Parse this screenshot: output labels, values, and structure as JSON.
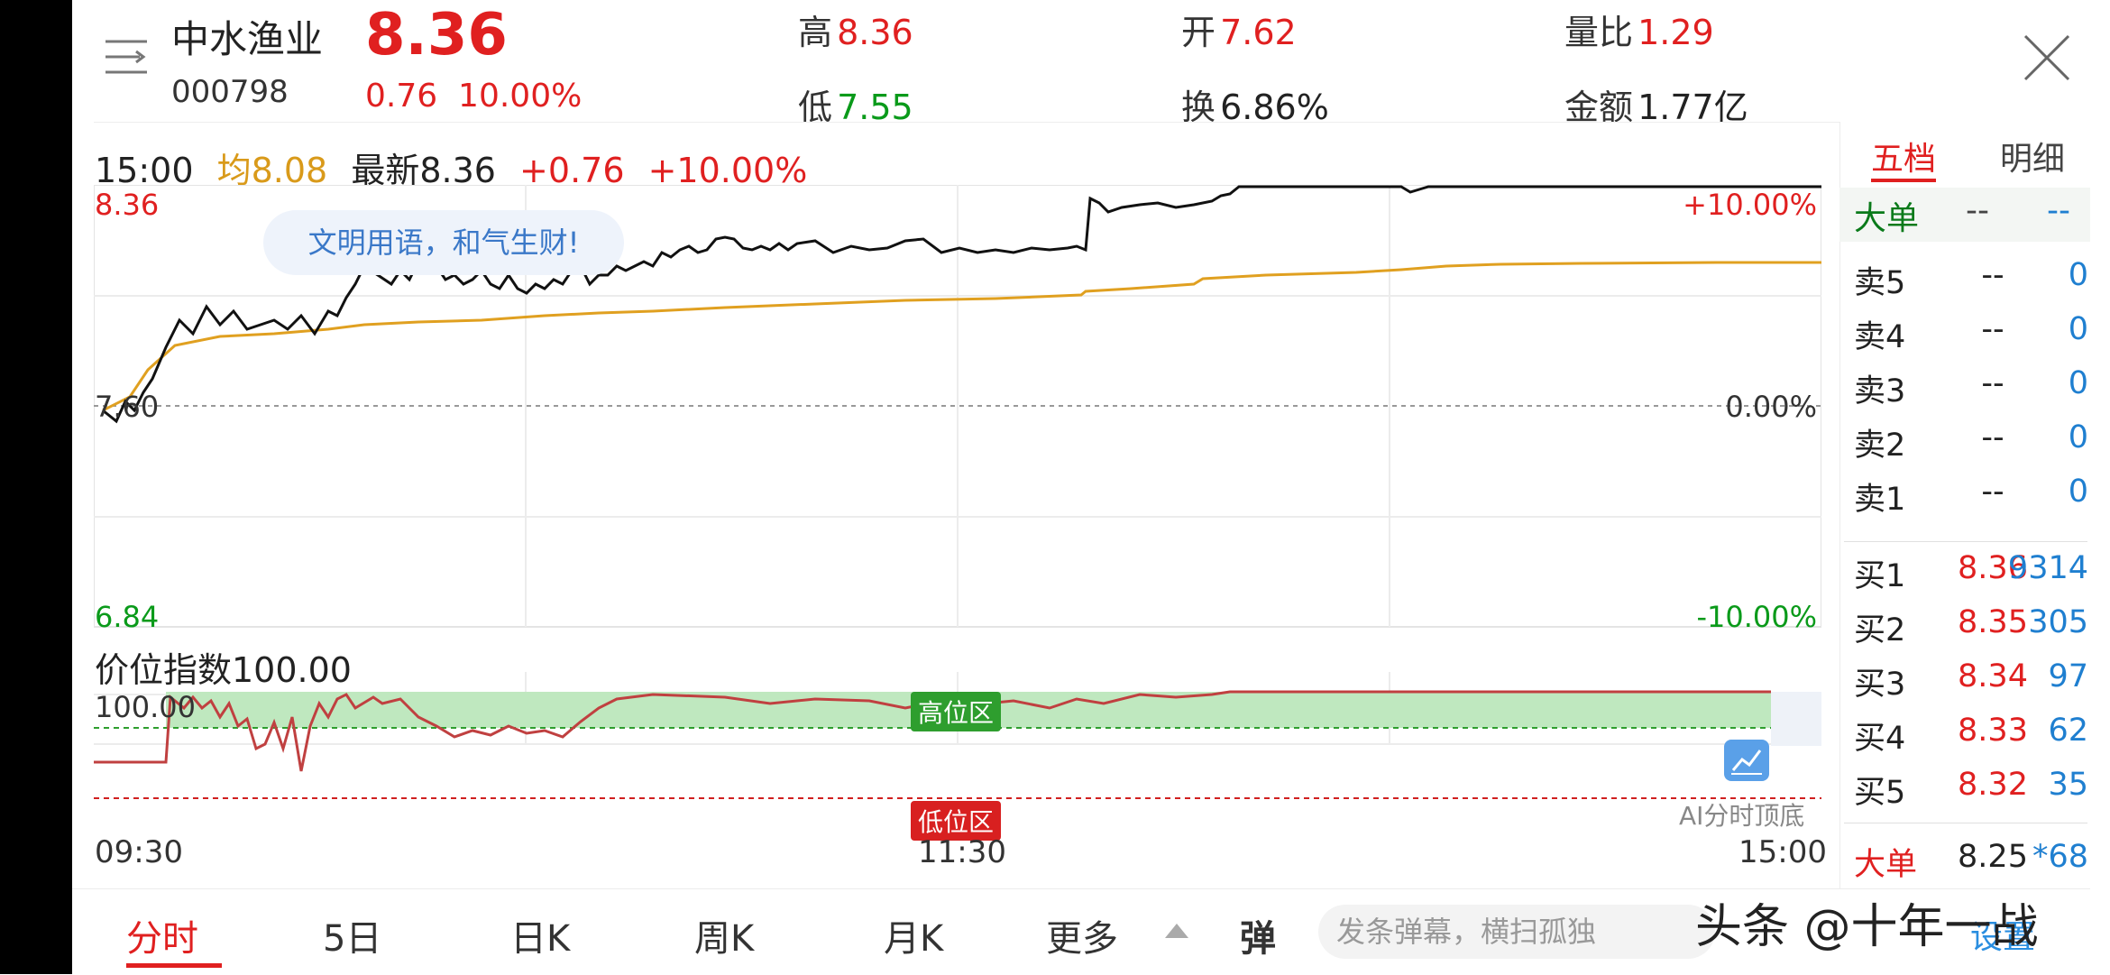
{
  "header": {
    "stock_name": "中水渔业",
    "stock_code": "000798",
    "price": "8.36",
    "change": "0.76",
    "change_pct": "10.00%",
    "high_label": "高",
    "high_value": "8.36",
    "low_label": "低",
    "low_value": "7.55",
    "open_label": "开",
    "open_value": "7.62",
    "turnover_label": "换",
    "turnover_value": "6.86%",
    "vol_ratio_label": "量比",
    "vol_ratio_value": "1.29",
    "amount_label": "金额",
    "amount_value": "1.77亿"
  },
  "info_line": {
    "time": "15:00",
    "avg_label": "均8.08",
    "latest_label": "最新8.36",
    "change": "+0.76",
    "change_pct": "+10.00%"
  },
  "chart_axes": {
    "y_top": "8.36",
    "y_mid": "7.60",
    "y_bottom": "6.84",
    "pct_top": "+10.00%",
    "pct_mid": "0.00%",
    "pct_bottom": "-10.00%",
    "x_start": "09:30",
    "x_mid": "11:30",
    "x_end": "15:00"
  },
  "bubble_text": "文明用语，和气生财!",
  "index_panel": {
    "title": "价位指数100.00",
    "level_100": "100.00",
    "high_zone": "高位区",
    "low_zone": "低位区"
  },
  "ai_label": "AI分时顶底",
  "right_panel": {
    "tabs": [
      "五档",
      "明细"
    ],
    "big_order_label": "大单",
    "big_order_price": "--",
    "big_order_vol": "--",
    "asks": [
      {
        "label": "卖5",
        "price": "--",
        "vol": "0"
      },
      {
        "label": "卖4",
        "price": "--",
        "vol": "0"
      },
      {
        "label": "卖3",
        "price": "--",
        "vol": "0"
      },
      {
        "label": "卖2",
        "price": "--",
        "vol": "0"
      },
      {
        "label": "卖1",
        "price": "--",
        "vol": "0"
      }
    ],
    "bids": [
      {
        "label": "买1",
        "price": "8.36",
        "vol": "9314"
      },
      {
        "label": "买2",
        "price": "8.35",
        "vol": "305"
      },
      {
        "label": "买3",
        "price": "8.34",
        "vol": "97"
      },
      {
        "label": "买4",
        "price": "8.33",
        "vol": "62"
      },
      {
        "label": "买5",
        "price": "8.32",
        "vol": "35"
      }
    ],
    "bottom_big_label": "大单",
    "bottom_big_price": "8.25",
    "bottom_big_vol": "*68"
  },
  "bottom_tabs": [
    "分时",
    "5日",
    "日K",
    "周K",
    "月K",
    "更多"
  ],
  "danmu_toggle": "弹",
  "danmu_placeholder": "发条弹幕，横扫孤独",
  "send_label": "设置",
  "watermark": "头条 @十年一战",
  "colors": {
    "up": "#e02020",
    "down": "#0a9a1a",
    "avg_line": "#e0a020",
    "price_line": "#111111",
    "annotation": "#2a8ee0"
  }
}
